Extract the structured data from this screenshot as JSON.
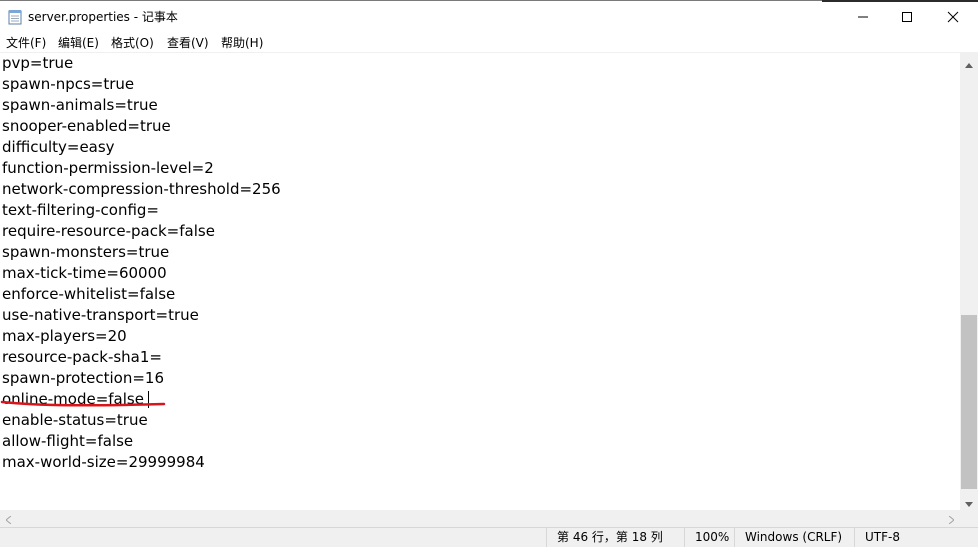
{
  "window": {
    "title": "server.properties - 记事本"
  },
  "icons": {
    "app": "notepad-icon",
    "minimize": "minimize-icon",
    "maximize": "maximize-icon",
    "close": "close-icon"
  },
  "menu": [
    {
      "label": "文件(F)"
    },
    {
      "label": "编辑(E)"
    },
    {
      "label": "格式(O)"
    },
    {
      "label": "查看(V)"
    },
    {
      "label": "帮助(H)"
    }
  ],
  "editor": {
    "lines": [
      "pvp=true",
      "spawn-npcs=true",
      "spawn-animals=true",
      "snooper-enabled=true",
      "difficulty=easy",
      "function-permission-level=2",
      "network-compression-threshold=256",
      "text-filtering-config=",
      "require-resource-pack=false",
      "spawn-monsters=true",
      "max-tick-time=60000",
      "enforce-whitelist=false",
      "use-native-transport=true",
      "max-players=20",
      "resource-pack-sha1=",
      "spawn-protection=16",
      "online-mode=false",
      "enable-status=true",
      "allow-flight=false",
      "max-world-size=29999984"
    ],
    "annotation_color": "#d9141a"
  },
  "status": {
    "position": "第 46 行，第 18 列",
    "zoom": "100%",
    "line_ending": "Windows (CRLF)",
    "encoding": "UTF-8"
  }
}
